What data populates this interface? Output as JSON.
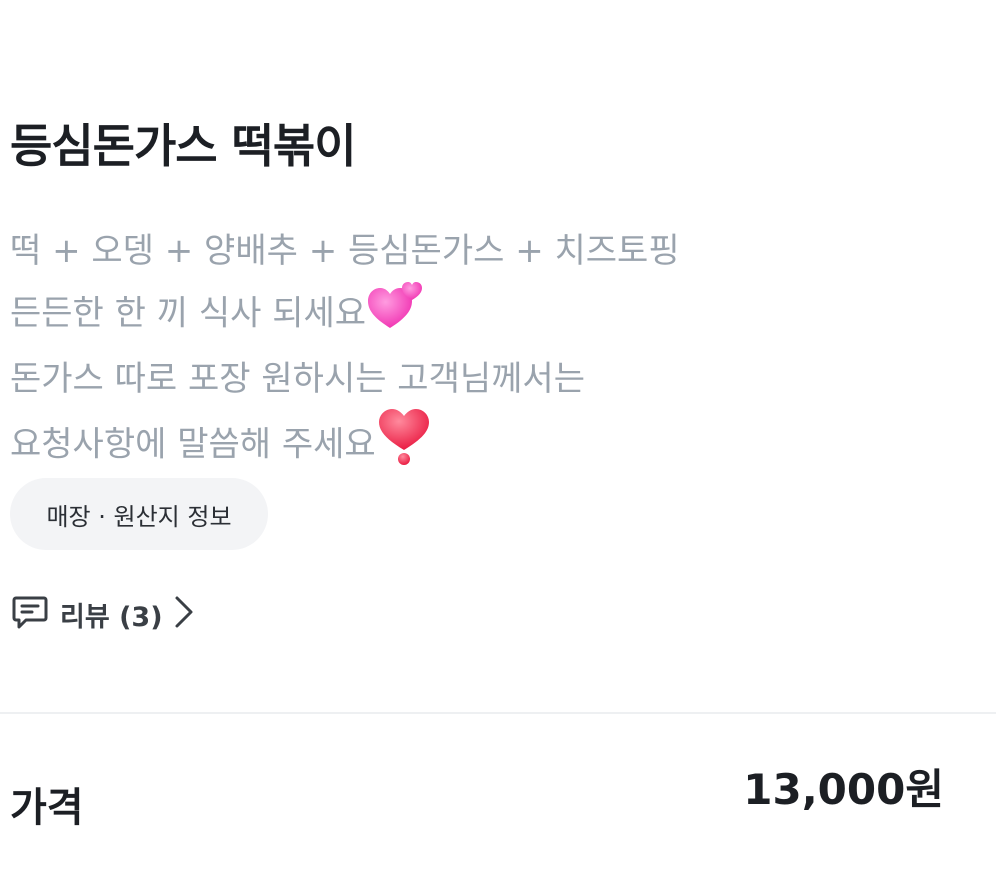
{
  "menu": {
    "title": "등심돈가스 떡볶이",
    "description_lines": [
      {
        "text": "떡 + 오뎅 + 양배추 + 등심돈가스 + 치즈토핑",
        "emoji": ""
      },
      {
        "text": "든든한 한 끼 식사 되세요",
        "emoji": "two-hearts"
      },
      {
        "text": "돈가스 따로 포장 원하시는 고객님께서는",
        "emoji": ""
      },
      {
        "text": "요청사항에 말씀해 주세요",
        "emoji": "heart-exclamation"
      }
    ],
    "store_info_chip": "매장 · 원산지 정보",
    "review_link": "리뷰 (3)",
    "review_icon": "comment-icon",
    "price_label": "가격",
    "price_value": "13,000원"
  },
  "colors": {
    "title": "#1c1f24",
    "description": "#9aa3ad",
    "chip_bg": "#f3f4f6",
    "divider": "#eef0f2",
    "heart_pink": "#ff4fb8",
    "heart_red": "#ff2d55"
  }
}
